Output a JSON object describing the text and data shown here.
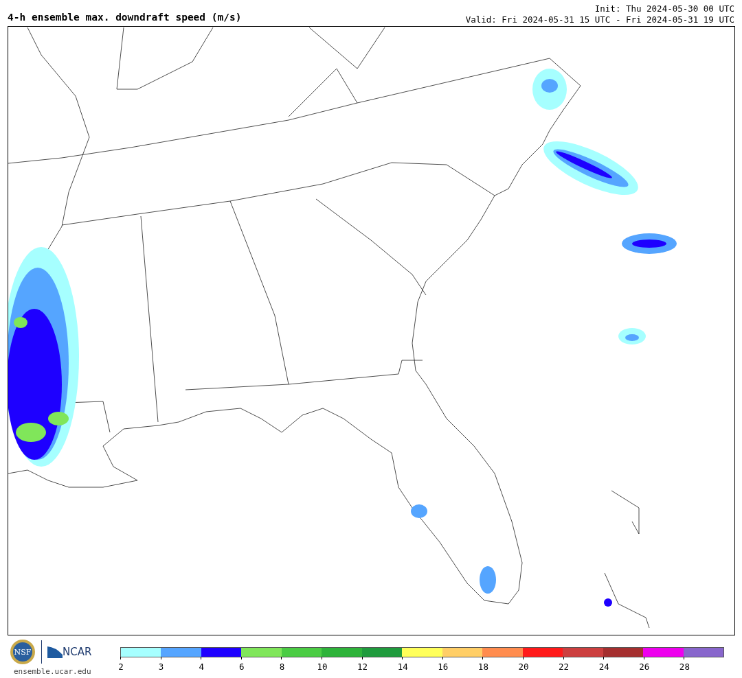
{
  "title": "4-h ensemble max. downdraft speed (m/s)",
  "init": "Init: Thu 2024-05-30 00 UTC",
  "valid": "Valid: Fri 2024-05-31 15 UTC - Fri 2024-05-31 19 UTC",
  "logos": {
    "nsf": "NSF",
    "ncar": "NCAR",
    "site": "ensemble.ucar.edu"
  },
  "colorbar": {
    "segments": [
      {
        "color": "#a6ffff"
      },
      {
        "color": "#55a5ff"
      },
      {
        "color": "#1e00ff"
      },
      {
        "color": "#80e65a"
      },
      {
        "color": "#4bcc44"
      },
      {
        "color": "#2eb33a"
      },
      {
        "color": "#1f9b3d"
      },
      {
        "color": "#ffff5a"
      },
      {
        "color": "#ffce66"
      },
      {
        "color": "#ff8c4e"
      },
      {
        "color": "#ff1a1a"
      },
      {
        "color": "#cc3f3f"
      },
      {
        "color": "#a52f2f"
      },
      {
        "color": "#ee00ee"
      },
      {
        "color": "#8866cc"
      }
    ],
    "ticks": [
      "2",
      "3",
      "4",
      "6",
      "8",
      "10",
      "12",
      "14",
      "16",
      "18",
      "20",
      "22",
      "24",
      "26",
      "28"
    ]
  }
}
